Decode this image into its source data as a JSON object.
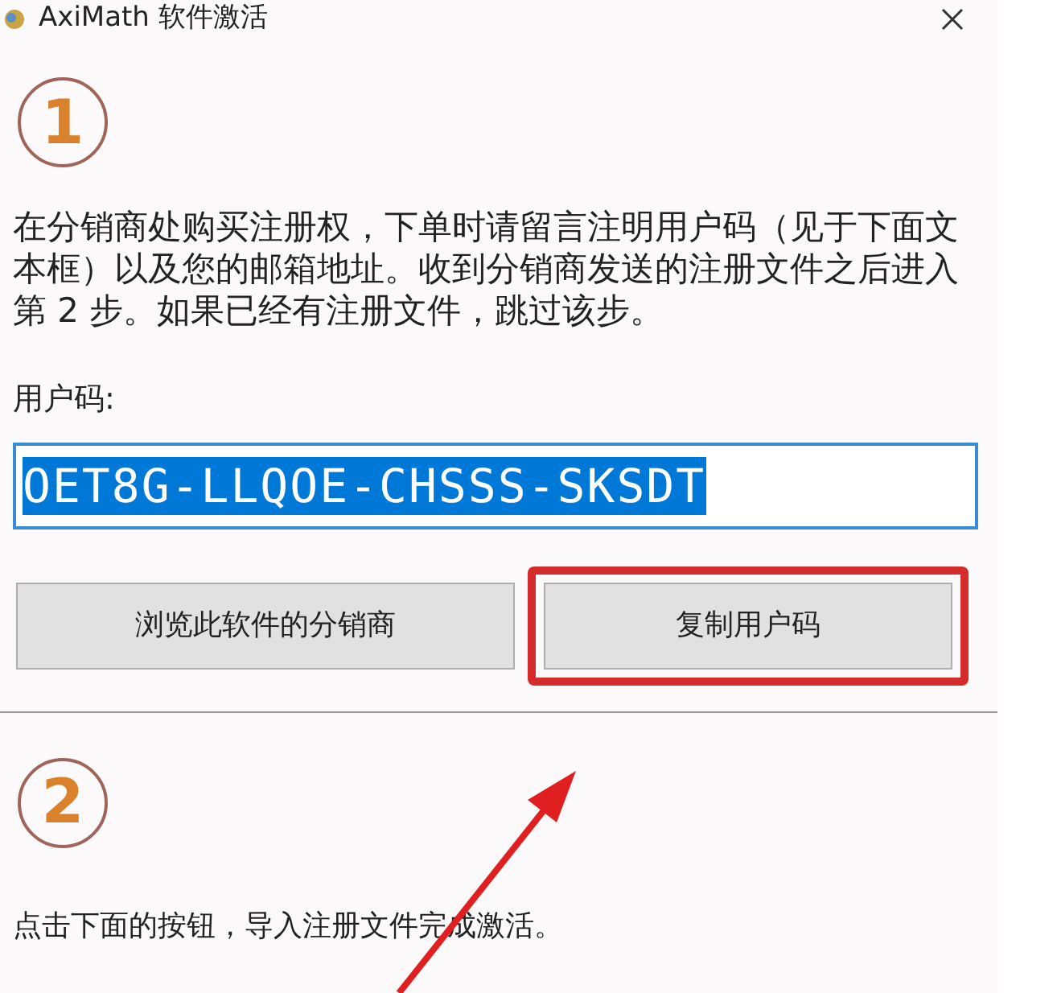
{
  "window": {
    "title": "AxiMath 软件激活"
  },
  "step_1": {
    "number": "1",
    "text": "在分销商处购买注册权，下单时请留言注明用户码（见于下面文本框）以及您的邮箱地址。收到分销商发送的注册文件之后进入第 2 步。如果已经有注册文件，跳过该步。",
    "code_label": "用户码:",
    "code_field": {
      "value": "OET8G-LLQOE-CHSSS-SKSDT",
      "selected": true
    },
    "buttons": [
      {
        "label": "浏览此软件的分销商",
        "highlighted": false
      },
      {
        "label": "复制用户码",
        "highlighted": true
      }
    ]
  },
  "step_2": {
    "number": "2",
    "text": "点击下面的按钮，导入注册文件完成激活。"
  }
}
